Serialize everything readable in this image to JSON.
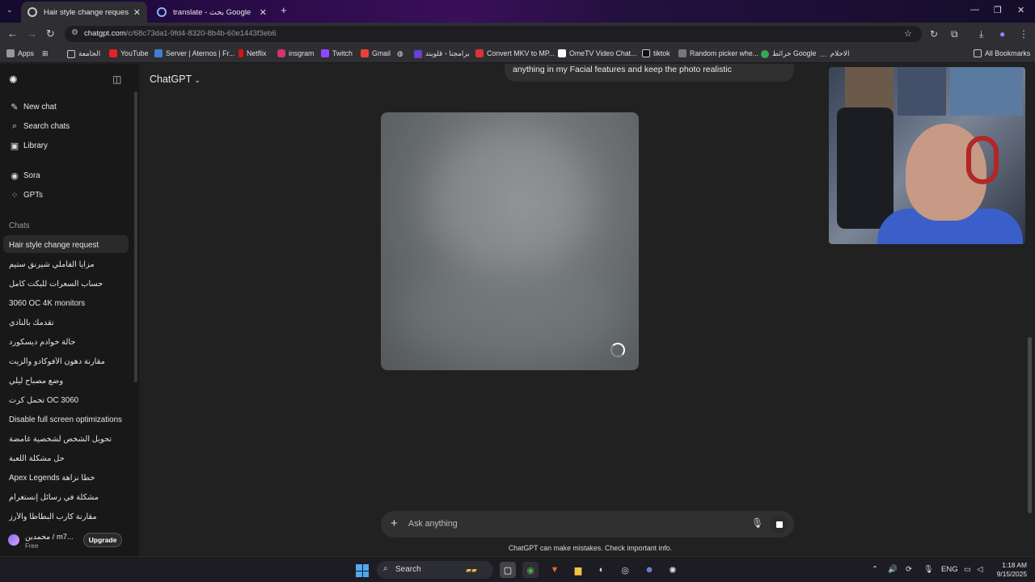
{
  "browser": {
    "tabs": [
      {
        "title": "Hair style change request",
        "active": true
      },
      {
        "title": "translate - بحث Google",
        "active": false
      }
    ],
    "new_tab": "+",
    "url_host": "chatgpt.com",
    "url_path": "/c/68c73da1-9fd4-8320-8b4b-60e1443f3eb6",
    "bookmarks": [
      "Apps",
      "الجامعة",
      "YouTube",
      "Server | Aternos | Fr...",
      "Netflix",
      "insgram",
      "Twitch",
      "Gmail",
      "برامجنا - قلويند",
      "Convert MKV to MP...",
      "OmeTV Video Chat...",
      "tiktok",
      "Random picker whe...",
      "خرائط Google",
      "الاحلام"
    ],
    "all_bookmarks": "All Bookmarks"
  },
  "sidebar": {
    "new_chat": "New chat",
    "search_chats": "Search chats",
    "library": "Library",
    "sora": "Sora",
    "gpts": "GPTs",
    "chats_heading": "Chats",
    "chats": [
      "Hair style change request",
      "مزايا الفاملي شيرنق ستيم",
      "حساب السعرات للبكت كامل",
      "3060 OC 4K monitors",
      "تقدمك بالنادي",
      "حالة خوادم ديسكورد",
      "مقارنة دهون الأفوكادو والزيت",
      "وضع مصباح ليلي",
      "تحمل كرت OC 3060",
      "Disable full screen optimizations",
      "تحويل الشخص لشخصية غامضة",
      "حل مشكلة اللعبة",
      "Apex Legends خطأ نزاهة",
      "مشكلة في رسائل إنستغرام",
      "مقارنة كارب البطاطا والأرز"
    ],
    "user_name": "محمدين / m7...",
    "user_plan": "Free",
    "upgrade": "Upgrade"
  },
  "main": {
    "model_title": "ChatGPT",
    "user_message": "anything in my Facial features and keep the photo realistic",
    "composer_placeholder": "Ask anything",
    "disclaimer": "ChatGPT can make mistakes. Check important info."
  },
  "taskbar": {
    "search": "Search",
    "lang": "ENG",
    "time": "1:18 AM",
    "date": "9/15/2025"
  },
  "colors": {
    "background": "#212121",
    "sidebar": "#181818",
    "composer": "#303030",
    "start_accent": "#4fa8f0"
  }
}
